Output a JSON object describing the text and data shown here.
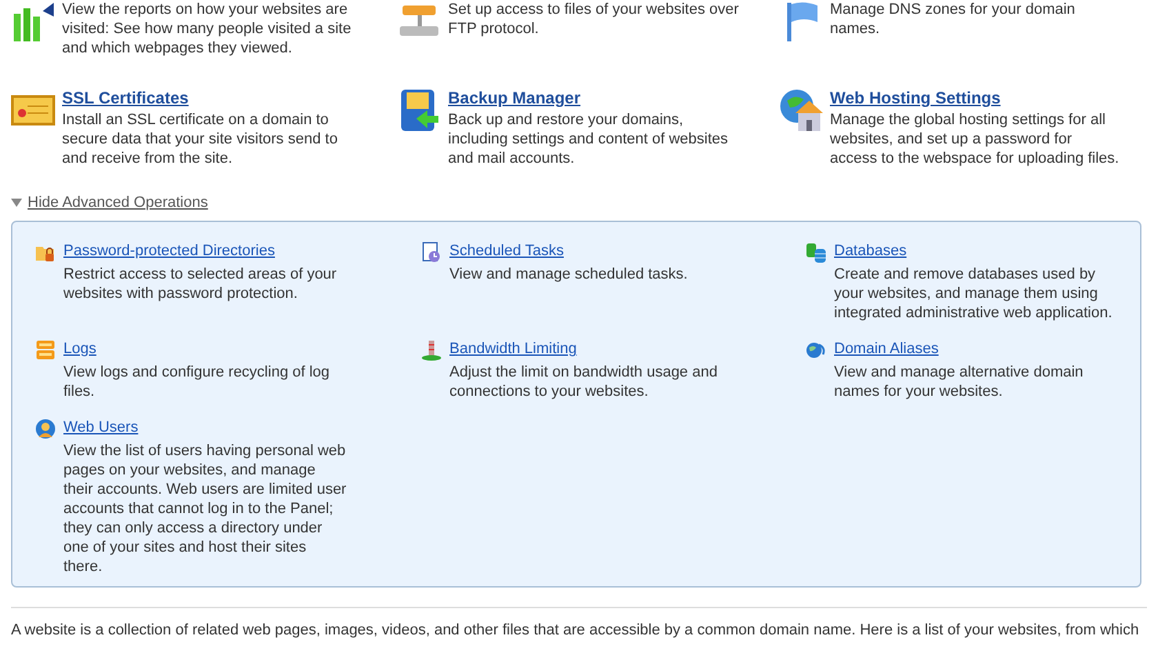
{
  "basic_tools": [
    {
      "kind": "stats",
      "description": "View the reports on how your websites are visited: See how many people visited a site and which webpages they viewed."
    },
    {
      "kind": "ftp",
      "description": "Set up access to files of your websites over FTP protocol."
    },
    {
      "kind": "dns",
      "description": "Manage DNS zones for your domain names."
    },
    {
      "kind": "ssl",
      "title": "SSL Certificates",
      "description": "Install an SSL certificate on a domain to secure data that your site visitors send to and receive from the site."
    },
    {
      "kind": "backup",
      "title": "Backup Manager",
      "description": "Back up and restore your domains, including settings and content of websites and mail accounts."
    },
    {
      "kind": "hosting",
      "title": "Web Hosting Settings",
      "description": "Manage the global hosting settings for all websites, and set up a password for access to the webspace for uploading files."
    }
  ],
  "advanced_toggle": {
    "label": "Hide Advanced Operations",
    "expanded": true
  },
  "advanced_tools": [
    {
      "kind": "folder",
      "title": "Password-protected Directories",
      "description": "Restrict access to selected areas of your websites with password protection."
    },
    {
      "kind": "tasks",
      "title": "Scheduled Tasks",
      "description": "View and manage scheduled tasks."
    },
    {
      "kind": "db",
      "title": "Databases",
      "description": "Create and remove databases used by your websites, and manage them using integrated administrative web application."
    },
    {
      "kind": "logs",
      "title": "Logs",
      "description": "View logs and configure recycling of log files."
    },
    {
      "kind": "bandwidth",
      "title": "Bandwidth Limiting",
      "description": "Adjust the limit on bandwidth usage and connections to your websites."
    },
    {
      "kind": "alias",
      "title": "Domain Aliases",
      "description": "View and manage alternative domain names for your websites."
    },
    {
      "kind": "users",
      "title": "Web Users",
      "description": "View the list of users having personal web pages on your websites, and manage their accounts. Web users are limited user accounts that cannot log in to the Panel; they can only access a directory under one of your sites and host their sites there."
    }
  ],
  "footer_text": "A website is a collection of related web pages, images, videos, and other files that are accessible by a common domain name. Here is a list of your websites, from which"
}
